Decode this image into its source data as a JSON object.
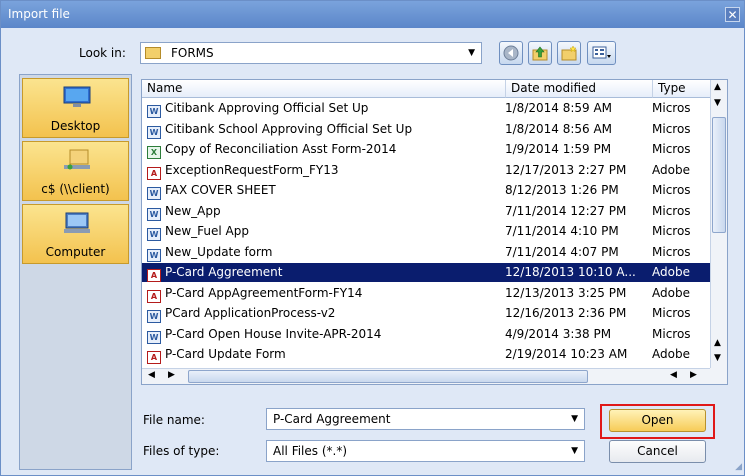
{
  "dialog": {
    "title": "Import file",
    "close_glyph": "✕"
  },
  "look_in": {
    "label": "Look in:",
    "value": "FORMS"
  },
  "toolbar": {
    "back_icon": "back-icon",
    "up_icon": "up-folder-icon",
    "new_folder_icon": "new-folder-icon",
    "view_icon": "view-menu-icon"
  },
  "places": [
    {
      "label": "Desktop",
      "icon": "desktop-icon"
    },
    {
      "label": "c$ (\\\\client)",
      "icon": "network-drive-icon"
    },
    {
      "label": "Computer",
      "icon": "computer-icon"
    }
  ],
  "columns": {
    "name": "Name",
    "date": "Date modified",
    "type": "Type"
  },
  "files": [
    {
      "name": "Citibank Approving Official Set Up",
      "date": "1/8/2014 8:59 AM",
      "type": "Micros",
      "icon": "word"
    },
    {
      "name": "Citibank School Approving Official Set Up",
      "date": "1/8/2014 8:56 AM",
      "type": "Micros",
      "icon": "word"
    },
    {
      "name": "Copy of Reconciliation Asst Form-2014",
      "date": "1/9/2014 1:59 PM",
      "type": "Micros",
      "icon": "excel"
    },
    {
      "name": "ExceptionRequestForm_FY13",
      "date": "12/17/2013 2:27 PM",
      "type": "Adobe",
      "icon": "pdf"
    },
    {
      "name": "FAX COVER SHEET",
      "date": "8/12/2013 1:26 PM",
      "type": "Micros",
      "icon": "word"
    },
    {
      "name": "New_App",
      "date": "7/11/2014 12:27 PM",
      "type": "Micros",
      "icon": "word"
    },
    {
      "name": "New_Fuel App",
      "date": "7/11/2014 4:10 PM",
      "type": "Micros",
      "icon": "word"
    },
    {
      "name": "New_Update form",
      "date": "7/11/2014 4:07 PM",
      "type": "Micros",
      "icon": "word"
    },
    {
      "name": "P-Card Aggreement",
      "date": "12/18/2013 10:10 A...",
      "type": "Adobe",
      "icon": "pdf",
      "selected": true
    },
    {
      "name": "P-Card AppAgreementForm-FY14",
      "date": "12/13/2013 3:25 PM",
      "type": "Adobe",
      "icon": "pdf"
    },
    {
      "name": "PCard ApplicationProcess-v2",
      "date": "12/16/2013 2:36 PM",
      "type": "Micros",
      "icon": "word"
    },
    {
      "name": "P-Card Open House Invite-APR-2014",
      "date": "4/9/2014 3:38 PM",
      "type": "Micros",
      "icon": "word"
    },
    {
      "name": "P-Card Update Form",
      "date": "2/19/2014 10:23 AM",
      "type": "Adobe",
      "icon": "pdf"
    }
  ],
  "file_name": {
    "label": "File name:",
    "value": "P-Card Aggreement"
  },
  "file_type": {
    "label": "Files of type:",
    "value": "All Files (*.*)"
  },
  "buttons": {
    "open": "Open",
    "cancel": "Cancel"
  },
  "colors": {
    "selection": "#0a1d6e",
    "highlight": "#e01818",
    "accent": "#5b86c9"
  }
}
